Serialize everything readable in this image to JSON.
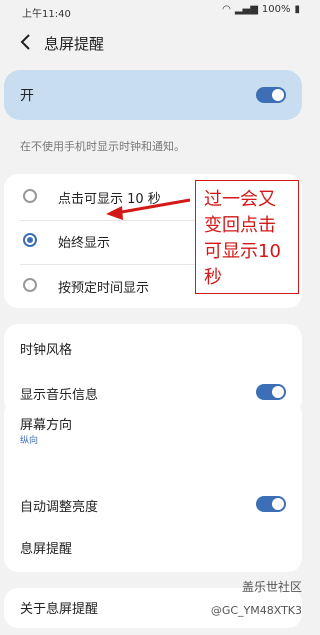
{
  "status_bar": {
    "time": "上午11:40",
    "battery": "100%"
  },
  "header": {
    "title": "息屏提醒"
  },
  "master": {
    "label": "开",
    "on": true
  },
  "hint": "在不使用手机时显示时钟和通知。",
  "display_modes": [
    {
      "label": "点击可显示 10 秒",
      "selected": false
    },
    {
      "label": "始终显示",
      "selected": true
    },
    {
      "label": "按预定时间显示",
      "selected": false
    }
  ],
  "annotation": [
    "过一会又",
    "变回点击",
    "可显示10",
    "秒"
  ],
  "settings": {
    "clock_style": "时钟风格",
    "music_info": "显示音乐信息",
    "orientation": "屏幕方向",
    "orientation_value": "纵向",
    "auto_brightness": "自动调整亮度",
    "aod": "息屏提醒",
    "about": "关于息屏提醒"
  },
  "watermark": {
    "line1": "盖乐世社区",
    "line2": "@GC_YM48XTK3"
  },
  "colors": {
    "accent": "#3d6fb7",
    "annotation": "#d31818",
    "master_bg": "#c9ddf0"
  }
}
